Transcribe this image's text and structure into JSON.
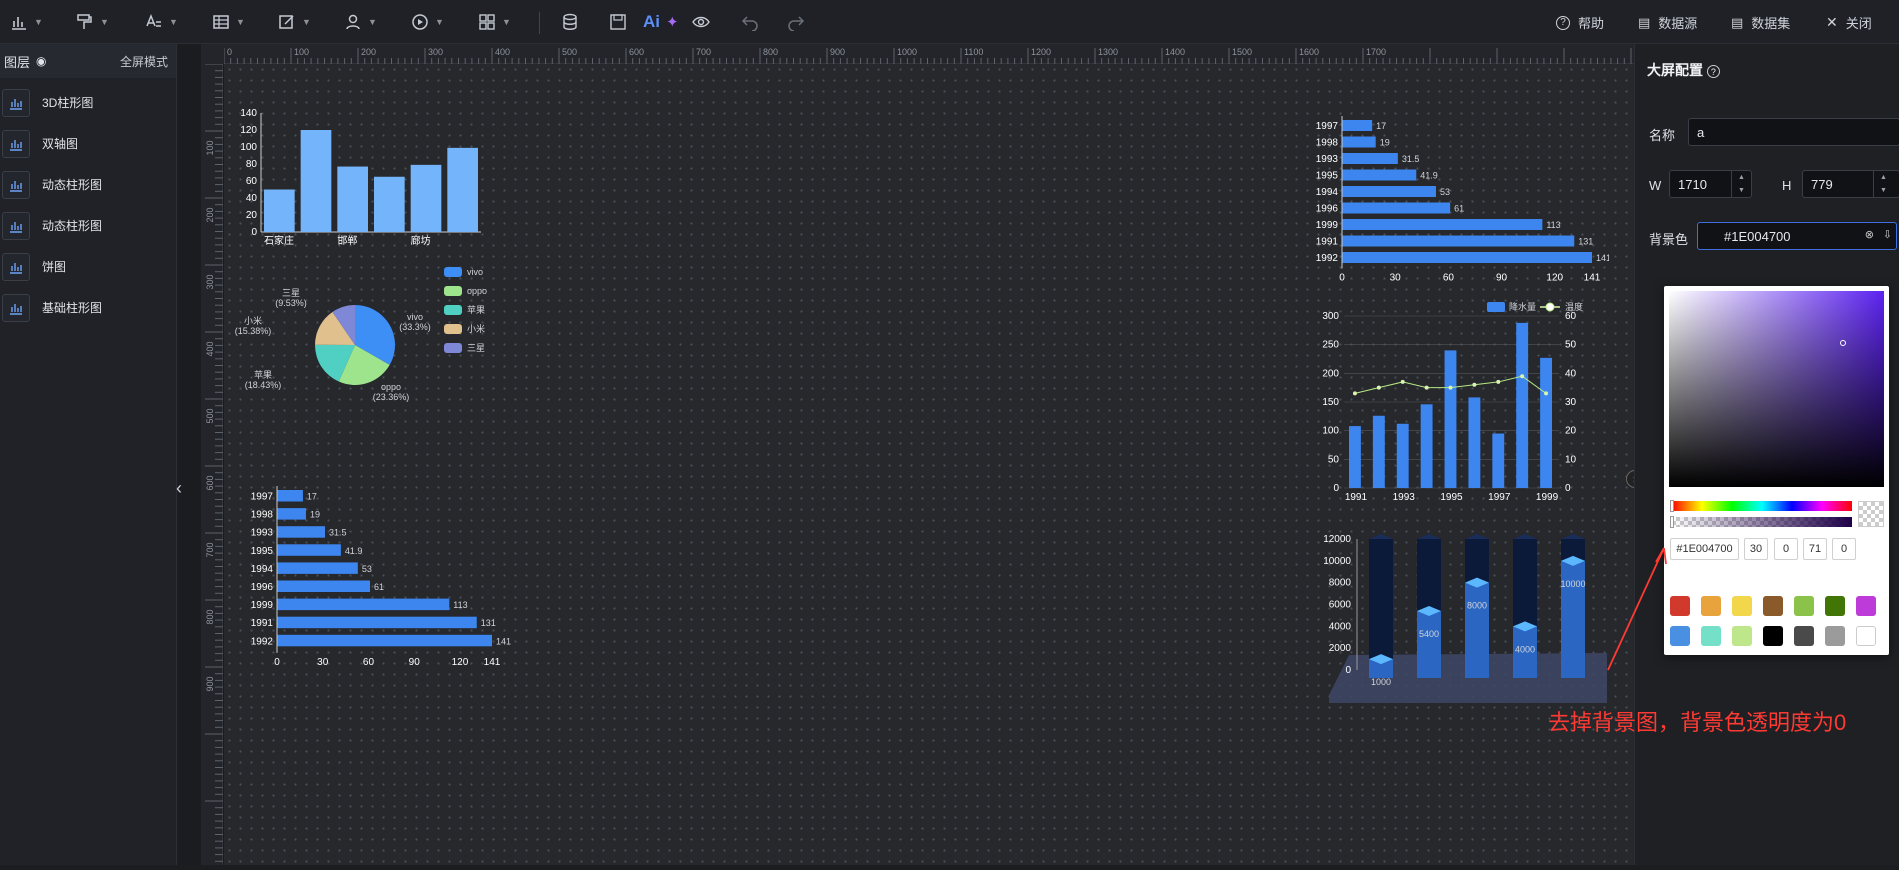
{
  "toolbar": {
    "help": "帮助",
    "datasource": "数据源",
    "dataset": "数据集",
    "close": "关闭",
    "ai": "Ai"
  },
  "left_panel": {
    "title": "图层",
    "fullscreen": "全屏模式",
    "layers": [
      "3D柱形图",
      "双轴图",
      "动态柱形图",
      "动态柱形图",
      "饼图",
      "基础柱形图"
    ]
  },
  "ruler": {
    "top_labels": [
      "0",
      "100",
      "200",
      "300",
      "400",
      "500",
      "600",
      "700",
      "800",
      "900",
      "1000",
      "1100",
      "1200",
      "1300",
      "1400",
      "1500",
      "1600",
      "1700"
    ],
    "left_labels": [
      "100",
      "200",
      "300",
      "400",
      "500",
      "600",
      "700",
      "800",
      "900"
    ]
  },
  "right_panel": {
    "title": "大屏配置",
    "name_label": "名称",
    "name_value": "a",
    "w_label": "W",
    "w_value": "1710",
    "h_label": "H",
    "h_value": "779",
    "bg_label": "背景色",
    "bg_value": "#1E004700"
  },
  "picker": {
    "hex": "#1E004700",
    "r": "30",
    "g": "0",
    "b": "71",
    "a": "0",
    "swatches": [
      "#d0392b",
      "#e8a33d",
      "#f2d64b",
      "#8b5a2b",
      "#8bc34a",
      "#417505",
      "#bd3bd8",
      "#4a90e2",
      "#74e0c8",
      "#bde78a",
      "#000000",
      "#4a4a4a",
      "#9b9b9b",
      "#ffffff"
    ]
  },
  "annotation": "去掉背景图，背景色透明度为0",
  "chart_data": [
    {
      "type": "bar",
      "categories": [
        "石家庄",
        "",
        "邯郸",
        "",
        "廊坊",
        ""
      ],
      "values": [
        50,
        120,
        77,
        65,
        79,
        99
      ],
      "ylim": [
        0,
        140
      ],
      "yticks": [
        "0",
        "20",
        "40",
        "60",
        "80",
        "100",
        "120",
        "140"
      ]
    },
    {
      "type": "pie",
      "labels": [
        "vivo",
        "oppo",
        "苹果",
        "小米",
        "三星"
      ],
      "values": [
        33.3,
        23.36,
        18.43,
        15.38,
        9.53
      ],
      "value_labels": [
        "(33.3%)",
        "(23.36%)",
        "(18.43%)",
        "(15.38%)",
        "(9.53%)"
      ],
      "colors": [
        "#3d8ef5",
        "#9de48c",
        "#4fd0c2",
        "#e0c08c",
        "#7e88d6"
      ]
    },
    {
      "type": "bar",
      "orientation": "horizontal",
      "categories": [
        "1997",
        "1998",
        "1993",
        "1995",
        "1994",
        "1996",
        "1999",
        "1991",
        "1992"
      ],
      "values": [
        "17",
        "19",
        "31.5",
        "41.9",
        "53",
        "61",
        "113",
        "131",
        "141"
      ],
      "xticks": [
        "0",
        "30",
        "60",
        "90",
        "120",
        "141"
      ],
      "xlim": [
        0,
        141
      ]
    },
    {
      "type": "bar",
      "orientation": "horizontal",
      "categories": [
        "1997",
        "1998",
        "1993",
        "1995",
        "1994",
        "1996",
        "1999",
        "1991",
        "1992"
      ],
      "values": [
        "17",
        "19",
        "31.5",
        "41.9",
        "53",
        "61",
        "113",
        "131",
        "141"
      ],
      "xticks": [
        "0",
        "30",
        "60",
        "90",
        "120",
        "141"
      ],
      "xlim": [
        0,
        141
      ]
    },
    {
      "type": "bar",
      "categories": [
        "1991",
        "1992",
        "1993",
        "1994",
        "1995",
        "1996",
        "1997",
        "1998",
        "1999"
      ],
      "series": [
        {
          "name": "降水量",
          "type": "bar",
          "values": [
            108,
            126,
            112,
            146,
            240,
            158,
            95,
            288,
            227
          ]
        },
        {
          "name": "温度",
          "type": "line",
          "values": [
            33,
            35,
            37,
            35,
            35,
            36,
            37,
            39,
            33
          ]
        }
      ],
      "ylim_left": [
        0,
        300
      ],
      "ylim_right": [
        0,
        60
      ],
      "yticks_left": [
        "0",
        "50",
        "100",
        "150",
        "200",
        "250",
        "300"
      ],
      "yticks_right": [
        "0",
        "10",
        "20",
        "30",
        "40",
        "50",
        "60"
      ],
      "xtick_labels": [
        "1991",
        "1993",
        "1995",
        "1997",
        "1999"
      ]
    },
    {
      "type": "bar",
      "style": "3d",
      "values": [
        1000,
        5400,
        8000,
        4000,
        10000
      ],
      "value_labels": [
        "1000",
        "5400",
        "8000",
        "4000",
        "10000"
      ],
      "ylim": [
        0,
        12000
      ],
      "yticks": [
        "0",
        "2000",
        "4000",
        "6000",
        "8000",
        "10000",
        "12000"
      ]
    }
  ]
}
